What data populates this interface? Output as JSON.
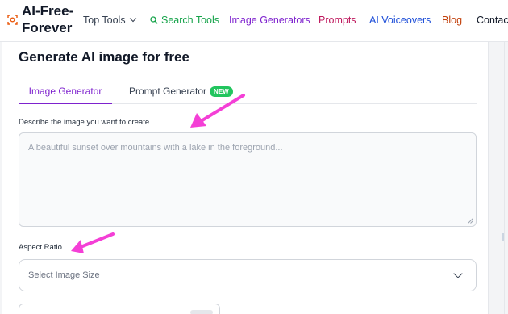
{
  "nav": {
    "brand": "AI-Free-\nForever",
    "items": [
      {
        "label": "Top Tools",
        "color": "#374151"
      },
      {
        "label": "Search Tools",
        "color": "#16a34a"
      },
      {
        "label": "Image Generators",
        "color": "#7e22ce"
      },
      {
        "label": "Prompts",
        "color": "#be185d"
      },
      {
        "label": "AI Voiceovers",
        "color": "#1d4ed8"
      },
      {
        "label": "Blog",
        "color": "#c2410c"
      },
      {
        "label": "Contact",
        "color": "#111827"
      }
    ]
  },
  "main": {
    "title": "Generate AI image for free",
    "tabs": [
      {
        "label": "Image Generator",
        "active": true
      },
      {
        "label": "Prompt Generator",
        "badge": "NEW"
      }
    ],
    "describe_label": "Describe the image you want to create",
    "describe_placeholder": "A beautiful sunset over mountains with a lake in the foreground...",
    "aspect_label": "Aspect Ratio",
    "aspect_placeholder": "Select Image Size"
  },
  "colors": {
    "accent": "#7e22ce",
    "annotation_arrow": "#f43fd6",
    "badge": "#22c55e"
  }
}
